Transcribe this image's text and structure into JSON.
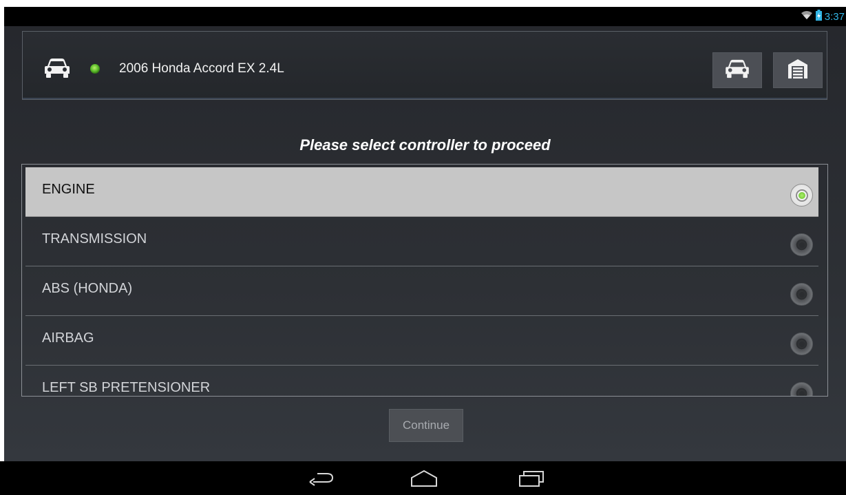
{
  "status_bar": {
    "time": "3:37",
    "icons": [
      "wifi-icon",
      "battery-charging-icon"
    ]
  },
  "header": {
    "vehicle_name": "2006 Honda Accord EX 2.4L",
    "connection_status_color": "#5bbd2a",
    "buttons": [
      {
        "name": "vehicle-button",
        "icon": "car-icon"
      },
      {
        "name": "garage-button",
        "icon": "garage-icon"
      }
    ]
  },
  "main": {
    "prompt": "Please select controller to proceed",
    "controllers": [
      {
        "label": "ENGINE",
        "selected": true
      },
      {
        "label": "TRANSMISSION",
        "selected": false
      },
      {
        "label": "ABS (HONDA)",
        "selected": false
      },
      {
        "label": "AIRBAG",
        "selected": false
      },
      {
        "label": "LEFT SB PRETENSIONER",
        "selected": false
      }
    ],
    "continue_label": "Continue"
  },
  "nav_bar": {
    "buttons": [
      "back-icon",
      "home-icon",
      "recent-apps-icon"
    ]
  },
  "colors": {
    "accent": "#33b5e5",
    "selected_row": "#c6c6c6",
    "radio_selected": "#5fbd23"
  }
}
